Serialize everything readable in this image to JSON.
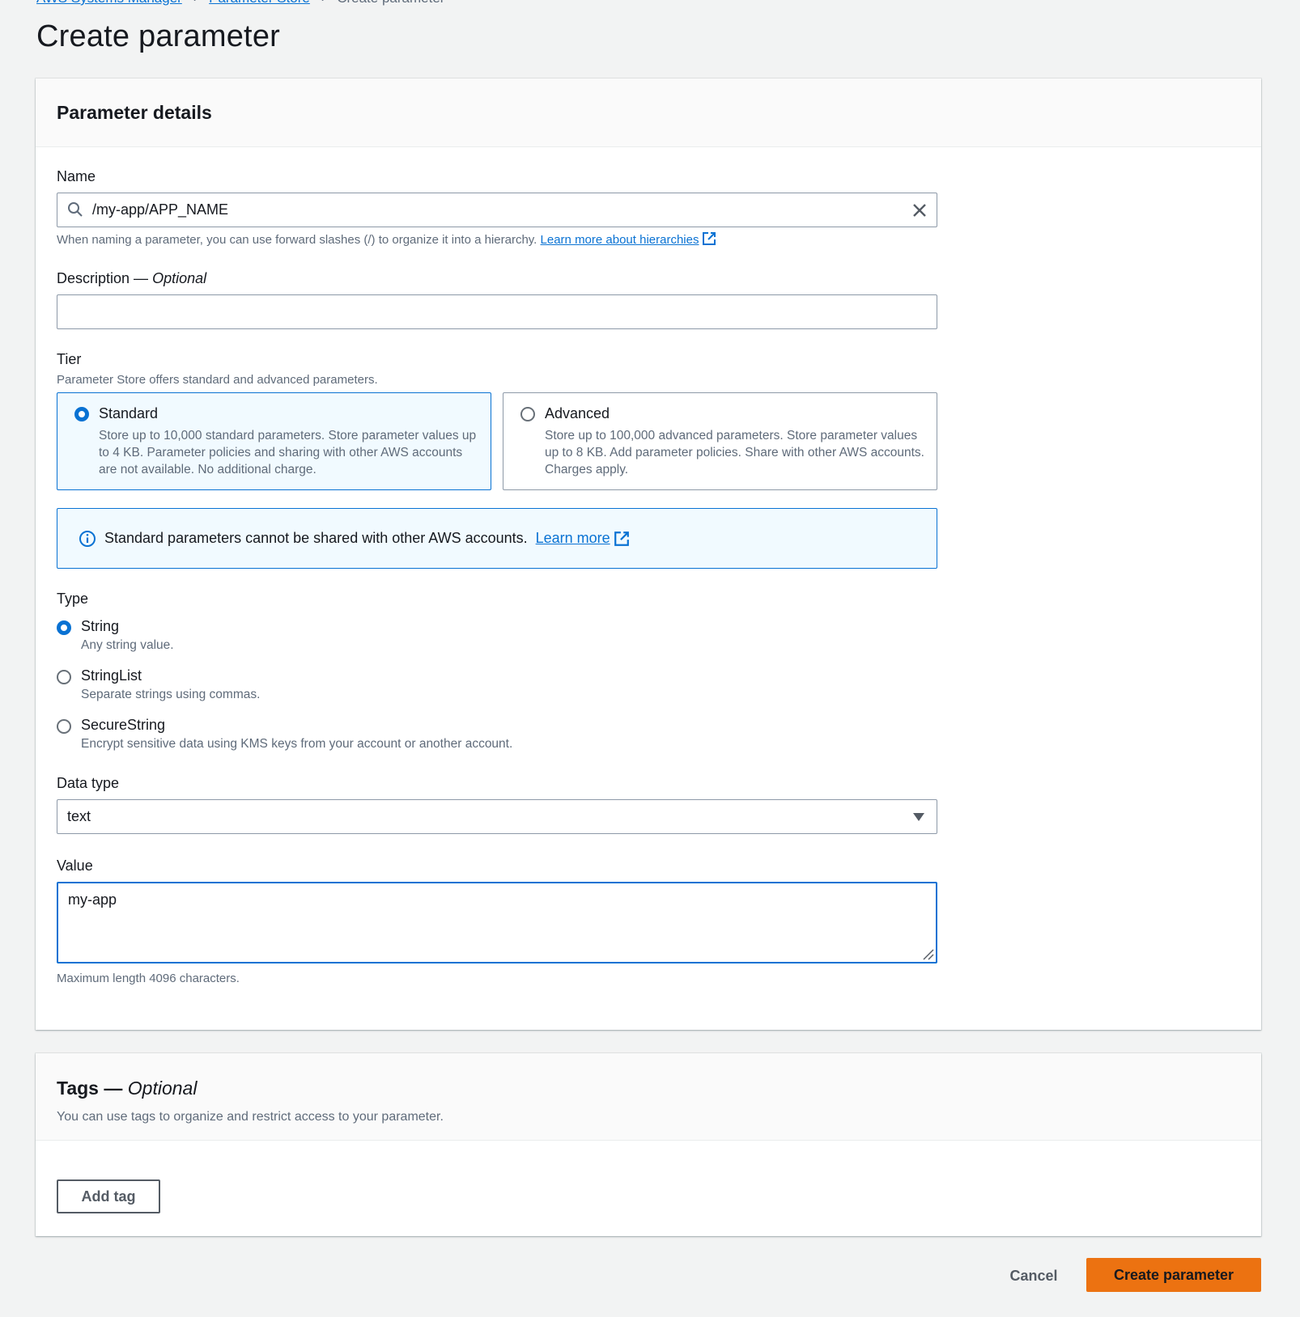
{
  "breadcrumb": {
    "items": [
      "AWS Systems Manager",
      "Parameter Store"
    ],
    "current": "Create parameter"
  },
  "page": {
    "title": "Create parameter"
  },
  "details": {
    "title": "Parameter details",
    "name": {
      "label": "Name",
      "value": "/my-app/APP_NAME",
      "hint": "When naming a parameter, you can use forward slashes (/) to organize it into a hierarchy.",
      "hint_link": "Learn more about hierarchies"
    },
    "description": {
      "label": "Description",
      "optional": "Optional",
      "value": ""
    },
    "tier": {
      "label": "Tier",
      "hint": "Parameter Store offers standard and advanced parameters.",
      "options": [
        {
          "title": "Standard",
          "desc": "Store up to 10,000 standard parameters. Store parameter values up to 4 KB. Parameter policies and sharing with other AWS accounts are not available. No additional charge.",
          "selected": true
        },
        {
          "title": "Advanced",
          "desc": "Store up to 100,000 advanced parameters. Store parameter values up to 8 KB. Add parameter policies. Share with other AWS accounts. Charges apply.",
          "selected": false
        }
      ]
    },
    "alert": {
      "text": "Standard parameters cannot be shared with other AWS accounts.",
      "link": "Learn more"
    },
    "type": {
      "label": "Type",
      "options": [
        {
          "label": "String",
          "desc": "Any string value.",
          "selected": true
        },
        {
          "label": "StringList",
          "desc": "Separate strings using commas.",
          "selected": false
        },
        {
          "label": "SecureString",
          "desc": "Encrypt sensitive data using KMS keys from your account or another account.",
          "selected": false
        }
      ]
    },
    "data_type": {
      "label": "Data type",
      "value": "text"
    },
    "value": {
      "label": "Value",
      "value": "my-app",
      "hint": "Maximum length 4096 characters."
    }
  },
  "tags": {
    "title": "Tags",
    "optional": "Optional",
    "desc": "You can use tags to organize and restrict access to your parameter.",
    "add_label": "Add tag"
  },
  "footer": {
    "cancel_label": "Cancel",
    "submit_label": "Create parameter"
  },
  "colors": {
    "link": "#0972d3",
    "primary": "#ec7211",
    "background": "#f2f3f3"
  }
}
